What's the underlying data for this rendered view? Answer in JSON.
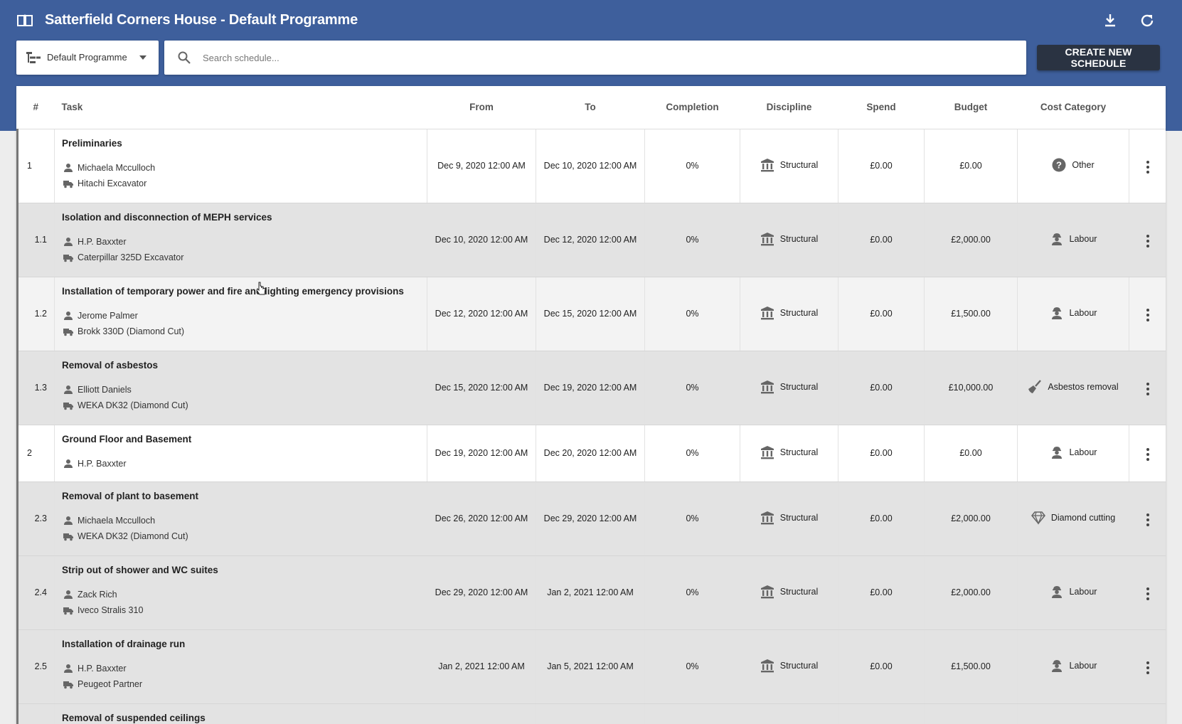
{
  "header": {
    "title": "Satterfield Corners House - Default Programme",
    "accent": "#3e5f9c"
  },
  "toolbar": {
    "programme_label": "Default Programme",
    "search_placeholder": "Search schedule...",
    "create_label": "CREATE NEW SCHEDULE"
  },
  "columns": {
    "num": "#",
    "task": "Task",
    "from": "From",
    "to": "To",
    "completion": "Completion",
    "discipline": "Discipline",
    "spend": "Spend",
    "budget": "Budget",
    "cost_category": "Cost Category"
  },
  "rows": [
    {
      "num": "1",
      "task": "Preliminaries",
      "person": "Michaela Mcculloch",
      "equipment": "Hitachi Excavator",
      "from": "Dec 9, 2020 12:00 AM",
      "to": "Dec 10, 2020 12:00 AM",
      "completion": "0%",
      "discipline": "Structural",
      "spend": "£0.00",
      "budget": "£0.00",
      "category": "Other",
      "category_icon": "help-circle-icon"
    },
    {
      "num": "1.1",
      "task": "Isolation and disconnection of MEPH services",
      "person": "H.P. Baxxter",
      "equipment": "Caterpillar 325D Excavator",
      "from": "Dec 10, 2020 12:00 AM",
      "to": "Dec 12, 2020 12:00 AM",
      "completion": "0%",
      "discipline": "Structural",
      "spend": "£0.00",
      "budget": "£2,000.00",
      "category": "Labour",
      "category_icon": "worker-icon"
    },
    {
      "num": "1.2",
      "task": "Installation of temporary power and fire and lighting emergency provisions",
      "person": "Jerome Palmer",
      "equipment": "Brokk 330D (Diamond Cut)",
      "from": "Dec 12, 2020 12:00 AM",
      "to": "Dec 15, 2020 12:00 AM",
      "completion": "0%",
      "discipline": "Structural",
      "spend": "£0.00",
      "budget": "£1,500.00",
      "category": "Labour",
      "category_icon": "worker-icon"
    },
    {
      "num": "1.3",
      "task": "Removal of asbestos",
      "person": "Elliott Daniels",
      "equipment": "WEKA DK32 (Diamond Cut)",
      "from": "Dec 15, 2020 12:00 AM",
      "to": "Dec 19, 2020 12:00 AM",
      "completion": "0%",
      "discipline": "Structural",
      "spend": "£0.00",
      "budget": "£10,000.00",
      "category": "Asbestos removal",
      "category_icon": "broom-icon"
    },
    {
      "num": "2",
      "task": "Ground Floor and Basement",
      "person": "H.P. Baxxter",
      "equipment": "",
      "from": "Dec 19, 2020 12:00 AM",
      "to": "Dec 20, 2020 12:00 AM",
      "completion": "0%",
      "discipline": "Structural",
      "spend": "£0.00",
      "budget": "£0.00",
      "category": "Labour",
      "category_icon": "worker-icon"
    },
    {
      "num": "2.3",
      "task": "Removal of plant to basement",
      "person": "Michaela Mcculloch",
      "equipment": "WEKA DK32 (Diamond Cut)",
      "from": "Dec 26, 2020 12:00 AM",
      "to": "Dec 29, 2020 12:00 AM",
      "completion": "0%",
      "discipline": "Structural",
      "spend": "£0.00",
      "budget": "£2,000.00",
      "category": "Diamond cutting",
      "category_icon": "diamond-icon"
    },
    {
      "num": "2.4",
      "task": "Strip out of shower and WC suites",
      "person": "Zack Rich",
      "equipment": "Iveco Stralis 310",
      "from": "Dec 29, 2020 12:00 AM",
      "to": "Jan 2, 2021 12:00 AM",
      "completion": "0%",
      "discipline": "Structural",
      "spend": "£0.00",
      "budget": "£2,000.00",
      "category": "Labour",
      "category_icon": "worker-icon"
    },
    {
      "num": "2.5",
      "task": "Installation of drainage run",
      "person": "H.P. Baxxter",
      "equipment": "Peugeot Partner",
      "from": "Jan 2, 2021 12:00 AM",
      "to": "Jan 5, 2021 12:00 AM",
      "completion": "0%",
      "discipline": "Structural",
      "spend": "£0.00",
      "budget": "£1,500.00",
      "category": "Labour",
      "category_icon": "worker-icon"
    },
    {
      "num": "",
      "task": "Removal of suspended ceilings",
      "person": "",
      "equipment": "",
      "from": "",
      "to": "",
      "completion": "",
      "discipline": "",
      "spend": "",
      "budget": "",
      "category": "",
      "category_icon": ""
    }
  ]
}
